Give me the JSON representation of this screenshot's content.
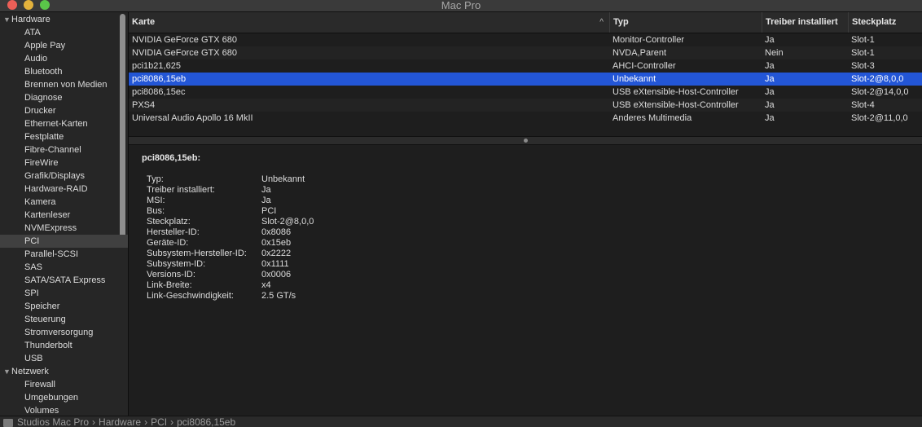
{
  "window": {
    "title": "Mac Pro"
  },
  "sidebar": {
    "sections": [
      {
        "label": "Hardware",
        "items": [
          "ATA",
          "Apple Pay",
          "Audio",
          "Bluetooth",
          "Brennen von Medien",
          "Diagnose",
          "Drucker",
          "Ethernet-Karten",
          "Festplatte",
          "Fibre-Channel",
          "FireWire",
          "Grafik/Displays",
          "Hardware-RAID",
          "Kamera",
          "Kartenleser",
          "NVMExpress",
          "PCI",
          "Parallel-SCSI",
          "SAS",
          "SATA/SATA Express",
          "SPI",
          "Speicher",
          "Steuerung",
          "Stromversorgung",
          "Thunderbolt",
          "USB"
        ]
      },
      {
        "label": "Netzwerk",
        "items": [
          "Firewall",
          "Umgebungen",
          "Volumes"
        ]
      }
    ],
    "selected": "PCI"
  },
  "table": {
    "columns": [
      "Karte",
      "Typ",
      "Treiber installiert",
      "Steckplatz"
    ],
    "rows": [
      [
        "NVIDIA GeForce GTX 680",
        "Monitor-Controller",
        "Ja",
        "Slot-1"
      ],
      [
        "NVIDIA GeForce GTX 680",
        "NVDA,Parent",
        "Nein",
        "Slot-1"
      ],
      [
        "pci1b21,625",
        "AHCI-Controller",
        "Ja",
        "Slot-3"
      ],
      [
        "pci8086,15eb",
        "Unbekannt",
        "Ja",
        "Slot-2@8,0,0"
      ],
      [
        "pci8086,15ec",
        "USB eXtensible-Host-Controller",
        "Ja",
        "Slot-2@14,0,0"
      ],
      [
        "PXS4",
        "USB eXtensible-Host-Controller",
        "Ja",
        "Slot-4"
      ],
      [
        "Universal Audio Apollo 16 MkII",
        "Anderes Multimedia",
        "Ja",
        "Slot-2@11,0,0"
      ]
    ],
    "selected_row": 3
  },
  "details": {
    "title": "pci8086,15eb:",
    "fields": [
      {
        "key": "Typ:",
        "value": "Unbekannt"
      },
      {
        "key": "Treiber installiert:",
        "value": "Ja"
      },
      {
        "key": "MSI:",
        "value": "Ja"
      },
      {
        "key": "Bus:",
        "value": "PCI"
      },
      {
        "key": "Steckplatz:",
        "value": "Slot-2@8,0,0"
      },
      {
        "key": "Hersteller-ID:",
        "value": "0x8086"
      },
      {
        "key": "Geräte-ID:",
        "value": "0x15eb"
      },
      {
        "key": "Subsystem-Hersteller-ID:",
        "value": "0x2222"
      },
      {
        "key": "Subsystem-ID:",
        "value": "0x1111"
      },
      {
        "key": "Versions-ID:",
        "value": "0x0006"
      },
      {
        "key": "Link-Breite:",
        "value": "x4"
      },
      {
        "key": "Link-Geschwindigkeit:",
        "value": "2.5 GT/s"
      }
    ]
  },
  "pathbar": {
    "icon": "computer-icon",
    "crumbs": [
      "Studios Mac Pro",
      "Hardware",
      "PCI",
      "pci8086,15eb"
    ]
  },
  "colors": {
    "selection": "#2356d6",
    "close": "#ec5f57",
    "minimize": "#e3b23c",
    "maximize": "#5ac649"
  }
}
